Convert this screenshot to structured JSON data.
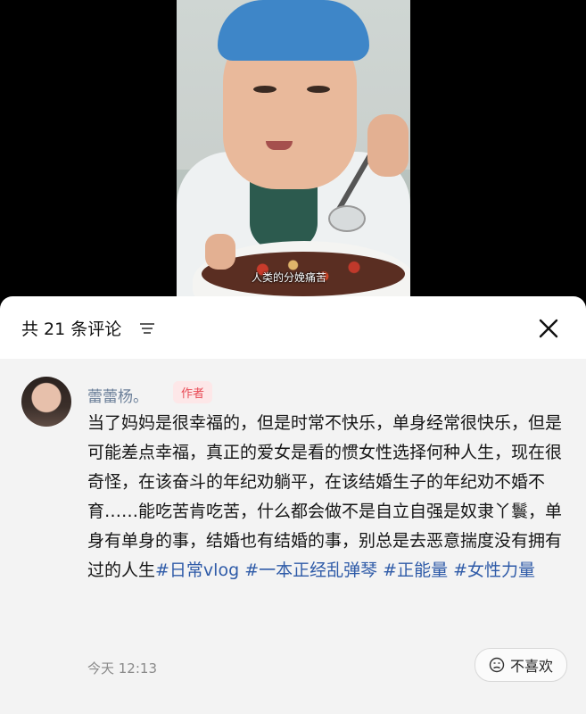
{
  "video": {
    "subtitle": "人类的分娩痛苦"
  },
  "comments_panel": {
    "title": "共 21 条评论",
    "comment": {
      "username": "蕾蕾杨。",
      "badge": "作者",
      "text": "当了妈妈是很幸福的，但是时常不快乐，单身经常很快乐，但是可能差点幸福，真正的爱女是看的惯女性选择何种人生，现在很奇怪，在该奋斗的年纪劝躺平，在该结婚生子的年纪劝不婚不育……能吃苦肯吃苦，什么都会做不是自立自强是奴隶丫鬟，单身有单身的事，结婚也有结婚的事，别总是去恶意揣度没有拥有过的人生",
      "tags": [
        "#日常vlog",
        "#一本正经乱弹琴",
        "#正能量",
        "#女性力量"
      ],
      "time": "今天 12:13",
      "dislike_label": "不喜欢"
    }
  },
  "colors": {
    "tag": "#2f5ba8",
    "badge_text": "#e84a55",
    "badge_bg": "#fde7e8",
    "username": "#6b7f99"
  },
  "icons": [
    "sort-icon",
    "close-icon",
    "dislike-face-icon"
  ]
}
